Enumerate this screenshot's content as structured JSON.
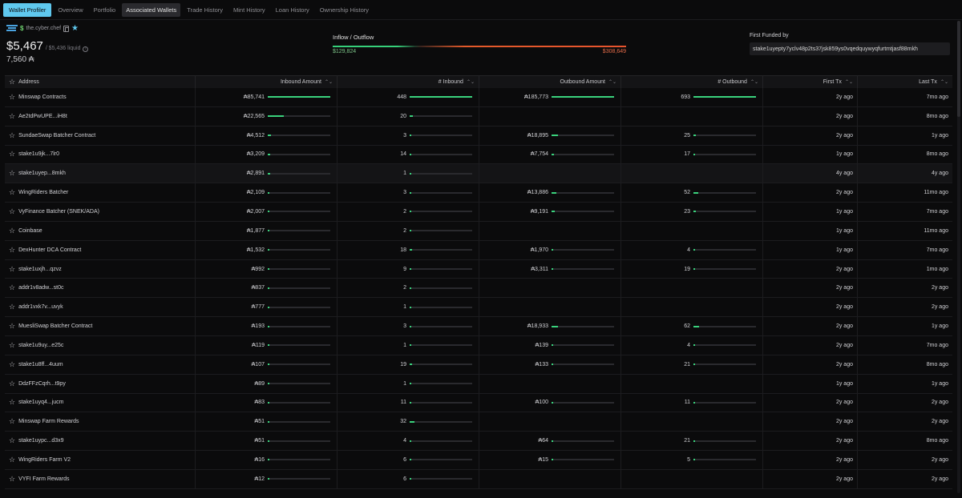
{
  "tabs": [
    {
      "label": "Wallet Profiler",
      "state": "primary"
    },
    {
      "label": "Overview",
      "state": ""
    },
    {
      "label": "Portfolio",
      "state": ""
    },
    {
      "label": "Associated Wallets",
      "state": "active"
    },
    {
      "label": "Trade History",
      "state": ""
    },
    {
      "label": "Mint History",
      "state": ""
    },
    {
      "label": "Loan History",
      "state": ""
    },
    {
      "label": "Ownership History",
      "state": ""
    }
  ],
  "profile": {
    "handle_symbol": "$",
    "handle": "the.cyber.chef",
    "value": "$5,467",
    "liquid": "/ $5,436 liquid",
    "info_glyph": "i",
    "ada_total": "7,560 ₳"
  },
  "flow": {
    "title": "Inflow / Outflow",
    "inflow": "$129,824",
    "outflow": "$308,649"
  },
  "funded": {
    "label": "First Funded by",
    "value": "stake1uyepty7yclv48p2ts37jsk859ys0vqedquywyqfurtmtjasf88mkh"
  },
  "table": {
    "columns": [
      "Address",
      "Inbound Amount",
      "# Inbound",
      "Outbound Amount",
      "# Outbound",
      "First Tx",
      "Last Tx"
    ],
    "sort_glyph": "⌃⌄",
    "star_glyph": "☆",
    "rows": [
      {
        "address": "Minswap Contracts",
        "in_amt": "₳85,741",
        "in_amt_v": 1.0,
        "in_n": "448",
        "in_n_v": 1.0,
        "out_amt": "₳185,773",
        "out_amt_v": 1.0,
        "out_n": "693",
        "out_n_v": 1.0,
        "first": "2y ago",
        "last": "7mo ago"
      },
      {
        "address": "Ae2tdPwUPE...iH8t",
        "in_amt": "₳22,565",
        "in_amt_v": 0.26,
        "in_n": "20",
        "in_n_v": 0.045,
        "out_amt": "",
        "out_amt_v": null,
        "out_n": "",
        "out_n_v": null,
        "first": "2y ago",
        "last": "8mo ago"
      },
      {
        "address": "SundaeSwap Batcher Contract",
        "in_amt": "₳4,512",
        "in_amt_v": 0.053,
        "in_n": "3",
        "in_n_v": 0.007,
        "out_amt": "₳18,895",
        "out_amt_v": 0.1,
        "out_n": "25",
        "out_n_v": 0.036,
        "first": "2y ago",
        "last": "1y ago"
      },
      {
        "address": "stake1u9jk...7lr0",
        "in_amt": "₳3,209",
        "in_amt_v": 0.037,
        "in_n": "14",
        "in_n_v": 0.031,
        "out_amt": "₳7,754",
        "out_amt_v": 0.042,
        "out_n": "17",
        "out_n_v": 0.025,
        "first": "1y ago",
        "last": "8mo ago"
      },
      {
        "address": "stake1uyep...8mkh",
        "in_amt": "₳2,891",
        "in_amt_v": 0.034,
        "in_n": "1",
        "in_n_v": 0.002,
        "out_amt": "",
        "out_amt_v": null,
        "out_n": "",
        "out_n_v": null,
        "first": "4y ago",
        "last": "4y ago",
        "highlight": true
      },
      {
        "address": "WingRiders Batcher",
        "in_amt": "₳2,109",
        "in_amt_v": 0.025,
        "in_n": "3",
        "in_n_v": 0.007,
        "out_amt": "₳13,886",
        "out_amt_v": 0.075,
        "out_n": "52",
        "out_n_v": 0.075,
        "first": "2y ago",
        "last": "11mo ago"
      },
      {
        "address": "VyFinance Batcher (SNEK/ADA)",
        "in_amt": "₳2,007",
        "in_amt_v": 0.023,
        "in_n": "2",
        "in_n_v": 0.004,
        "out_amt": "₳9,191",
        "out_amt_v": 0.049,
        "out_n": "23",
        "out_n_v": 0.033,
        "first": "1y ago",
        "last": "7mo ago"
      },
      {
        "address": "Coinbase",
        "in_amt": "₳1,877",
        "in_amt_v": 0.022,
        "in_n": "2",
        "in_n_v": 0.004,
        "out_amt": "",
        "out_amt_v": null,
        "out_n": "",
        "out_n_v": null,
        "first": "1y ago",
        "last": "11mo ago"
      },
      {
        "address": "DexHunter DCA Contract",
        "in_amt": "₳1,532",
        "in_amt_v": 0.018,
        "in_n": "18",
        "in_n_v": 0.04,
        "out_amt": "₳1,970",
        "out_amt_v": 0.011,
        "out_n": "4",
        "out_n_v": 0.006,
        "first": "1y ago",
        "last": "7mo ago"
      },
      {
        "address": "stake1uxjh...qzvz",
        "in_amt": "₳992",
        "in_amt_v": 0.012,
        "in_n": "9",
        "in_n_v": 0.02,
        "out_amt": "₳3,311",
        "out_amt_v": 0.018,
        "out_n": "19",
        "out_n_v": 0.027,
        "first": "2y ago",
        "last": "1mo ago"
      },
      {
        "address": "addr1v8adw...st0c",
        "in_amt": "₳837",
        "in_amt_v": 0.01,
        "in_n": "2",
        "in_n_v": 0.004,
        "out_amt": "",
        "out_amt_v": null,
        "out_n": "",
        "out_n_v": null,
        "first": "2y ago",
        "last": "2y ago"
      },
      {
        "address": "addr1vxk7v...uvyk",
        "in_amt": "₳777",
        "in_amt_v": 0.009,
        "in_n": "1",
        "in_n_v": 0.002,
        "out_amt": "",
        "out_amt_v": null,
        "out_n": "",
        "out_n_v": null,
        "first": "2y ago",
        "last": "2y ago"
      },
      {
        "address": "MuesliSwap Batcher Contract",
        "in_amt": "₳193",
        "in_amt_v": 0.002,
        "in_n": "3",
        "in_n_v": 0.007,
        "out_amt": "₳18,933",
        "out_amt_v": 0.1,
        "out_n": "62",
        "out_n_v": 0.09,
        "first": "2y ago",
        "last": "1y ago"
      },
      {
        "address": "stake1u9uy...e25c",
        "in_amt": "₳119",
        "in_amt_v": 0.001,
        "in_n": "1",
        "in_n_v": 0.002,
        "out_amt": "₳139",
        "out_amt_v": 0.001,
        "out_n": "4",
        "out_n_v": 0.006,
        "first": "2y ago",
        "last": "7mo ago"
      },
      {
        "address": "stake1u8ff...4uum",
        "in_amt": "₳107",
        "in_amt_v": 0.001,
        "in_n": "19",
        "in_n_v": 0.042,
        "out_amt": "₳133",
        "out_amt_v": 0.001,
        "out_n": "21",
        "out_n_v": 0.03,
        "first": "2y ago",
        "last": "8mo ago"
      },
      {
        "address": "DdzFFzCqrh...t9py",
        "in_amt": "₳89",
        "in_amt_v": 0.001,
        "in_n": "1",
        "in_n_v": 0.002,
        "out_amt": "",
        "out_amt_v": null,
        "out_n": "",
        "out_n_v": null,
        "first": "1y ago",
        "last": "1y ago"
      },
      {
        "address": "stake1uyq4...jucm",
        "in_amt": "₳83",
        "in_amt_v": 0.001,
        "in_n": "11",
        "in_n_v": 0.025,
        "out_amt": "₳100",
        "out_amt_v": 0.001,
        "out_n": "11",
        "out_n_v": 0.016,
        "first": "2y ago",
        "last": "2y ago"
      },
      {
        "address": "Minswap Farm Rewards",
        "in_amt": "₳51",
        "in_amt_v": 0.001,
        "in_n": "32",
        "in_n_v": 0.071,
        "out_amt": "",
        "out_amt_v": null,
        "out_n": "",
        "out_n_v": null,
        "first": "2y ago",
        "last": "2y ago"
      },
      {
        "address": "stake1uypc...d3x9",
        "in_amt": "₳51",
        "in_amt_v": 0.001,
        "in_n": "4",
        "in_n_v": 0.009,
        "out_amt": "₳64",
        "out_amt_v": 0.001,
        "out_n": "21",
        "out_n_v": 0.03,
        "first": "2y ago",
        "last": "8mo ago"
      },
      {
        "address": "WingRiders Farm V2",
        "in_amt": "₳16",
        "in_amt_v": 0.0005,
        "in_n": "6",
        "in_n_v": 0.013,
        "out_amt": "₳15",
        "out_amt_v": 0.0005,
        "out_n": "5",
        "out_n_v": 0.007,
        "first": "2y ago",
        "last": "2y ago"
      },
      {
        "address": "VYFI Farm Rewards",
        "in_amt": "₳12",
        "in_amt_v": 0.0004,
        "in_n": "6",
        "in_n_v": 0.013,
        "out_amt": "",
        "out_amt_v": null,
        "out_n": "",
        "out_n_v": null,
        "first": "2y ago",
        "last": "2y ago"
      }
    ]
  }
}
